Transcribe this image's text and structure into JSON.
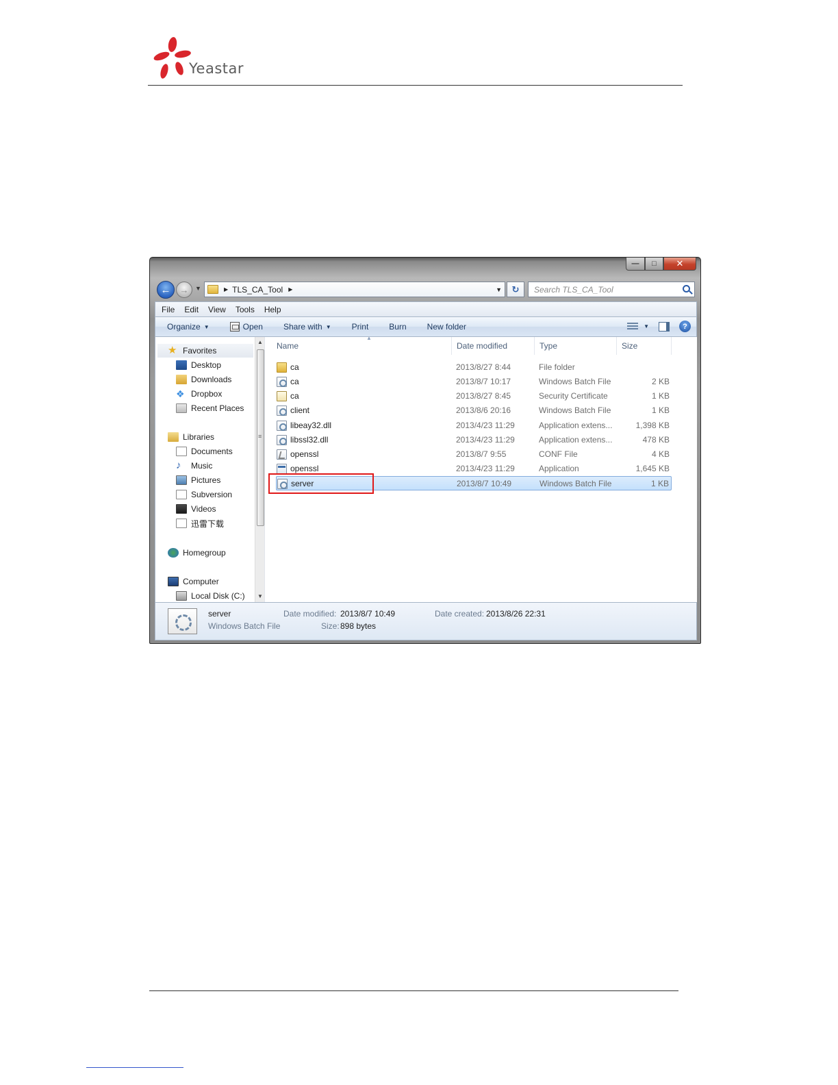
{
  "brand": {
    "name": "Yeastar"
  },
  "window": {
    "controls": {
      "minimize": "—",
      "maximize": "□",
      "close": "✕"
    }
  },
  "nav": {
    "back_icon": "back-arrow-icon",
    "forward_icon": "forward-arrow-icon",
    "address_path": "TLS_CA_Tool",
    "search_placeholder": "Search TLS_CA_Tool"
  },
  "menu": [
    "File",
    "Edit",
    "View",
    "Tools",
    "Help"
  ],
  "toolbar": {
    "organize": "Organize",
    "open": "Open",
    "share_with": "Share with",
    "print": "Print",
    "burn": "Burn",
    "new_folder": "New folder"
  },
  "sidebar": {
    "favorites": {
      "label": "Favorites",
      "items": [
        "Desktop",
        "Downloads",
        "Dropbox",
        "Recent Places"
      ]
    },
    "libraries": {
      "label": "Libraries",
      "items": [
        "Documents",
        "Music",
        "Pictures",
        "Subversion",
        "Videos",
        "迅雷下载"
      ]
    },
    "homegroup": "Homegroup",
    "computer": {
      "label": "Computer",
      "items": [
        "Local Disk (C:)"
      ]
    }
  },
  "columns": {
    "name": "Name",
    "date_modified": "Date modified",
    "type": "Type",
    "size": "Size"
  },
  "files": [
    {
      "name": "ca",
      "date": "2013/8/27 8:44",
      "type": "File folder",
      "size": "",
      "icon": "folder"
    },
    {
      "name": "ca",
      "date": "2013/8/7 10:17",
      "type": "Windows Batch File",
      "size": "2 KB",
      "icon": "batch"
    },
    {
      "name": "ca",
      "date": "2013/8/27 8:45",
      "type": "Security Certificate",
      "size": "1 KB",
      "icon": "cert"
    },
    {
      "name": "client",
      "date": "2013/8/6 20:16",
      "type": "Windows Batch File",
      "size": "1 KB",
      "icon": "batch"
    },
    {
      "name": "libeay32.dll",
      "date": "2013/4/23 11:29",
      "type": "Application extens...",
      "size": "1,398 KB",
      "icon": "dll"
    },
    {
      "name": "libssl32.dll",
      "date": "2013/4/23 11:29",
      "type": "Application extens...",
      "size": "478 KB",
      "icon": "dll"
    },
    {
      "name": "openssl",
      "date": "2013/8/7 9:55",
      "type": "CONF File",
      "size": "4 KB",
      "icon": "conf"
    },
    {
      "name": "openssl",
      "date": "2013/4/23 11:29",
      "type": "Application",
      "size": "1,645 KB",
      "icon": "exe"
    },
    {
      "name": "server",
      "date": "2013/8/7 10:49",
      "type": "Windows Batch File",
      "size": "1 KB",
      "icon": "batch",
      "selected": true
    }
  ],
  "details": {
    "name": "server",
    "type": "Windows Batch File",
    "date_modified_label": "Date modified:",
    "date_modified": "2013/8/7 10:49",
    "size_label": "Size:",
    "size": "898 bytes",
    "date_created_label": "Date created:",
    "date_created": "2013/8/26 22:31"
  },
  "colors": {
    "selection": "#c4e0fc",
    "highlight_box": "#e01818",
    "close_button": "#c4422b"
  }
}
